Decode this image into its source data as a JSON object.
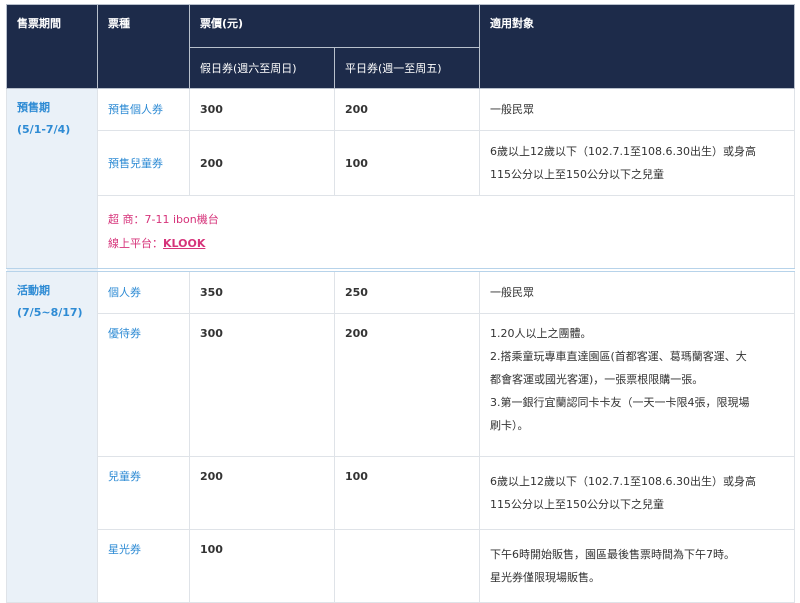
{
  "header": {
    "period": "售票期間",
    "ticket_type": "票種",
    "price": "票價(元)",
    "audience": "適用對象",
    "holiday": "假日券(週六至周日)",
    "weekday": "平日券(週一至周五)"
  },
  "presale": {
    "period_name": "預售期",
    "period_dates": "(5/1-7/4)",
    "rows": [
      {
        "ticket": "預售個人券",
        "holiday": "300",
        "weekday": "200",
        "audience": [
          "一般民眾"
        ]
      },
      {
        "ticket": "預售兒童券",
        "holiday": "200",
        "weekday": "100",
        "audience": [
          "6歲以上12歲以下（102.7.1至108.6.30出生）或身高",
          "115公分以上至150公分以下之兒童"
        ]
      }
    ],
    "note_line1": "超 商：7-11 ibon機台",
    "note_line2_prefix": "線上平台：",
    "note_link": "KLOOK"
  },
  "event": {
    "period_name": "活動期",
    "period_dates": "(7/5~8/17)",
    "rows": [
      {
        "ticket": "個人券",
        "holiday": "350",
        "weekday": "250",
        "audience": [
          "一般民眾"
        ]
      },
      {
        "ticket": "優待券",
        "holiday": "300",
        "weekday": "200",
        "audience": [
          "1.20人以上之團體。",
          "2.搭乘童玩專車直達園區(首都客運、葛瑪蘭客運、大",
          "都會客運或國光客運)，一張票根限購一張。",
          "3.第一銀行宜蘭認同卡卡友（一天一卡限4張，限現場",
          "刷卡）。"
        ]
      },
      {
        "ticket": "兒童券",
        "holiday": "200",
        "weekday": "100",
        "audience": [
          "6歲以上12歲以下（102.7.1至108.6.30出生）或身高",
          "115公分以上至150公分以下之兒童"
        ]
      },
      {
        "ticket": "星光券",
        "holiday": "100",
        "weekday": "",
        "audience": [
          "下午6時開始販售，園區最後售票時間為下午7時。",
          "星光券僅限現場販售。"
        ]
      }
    ]
  }
}
